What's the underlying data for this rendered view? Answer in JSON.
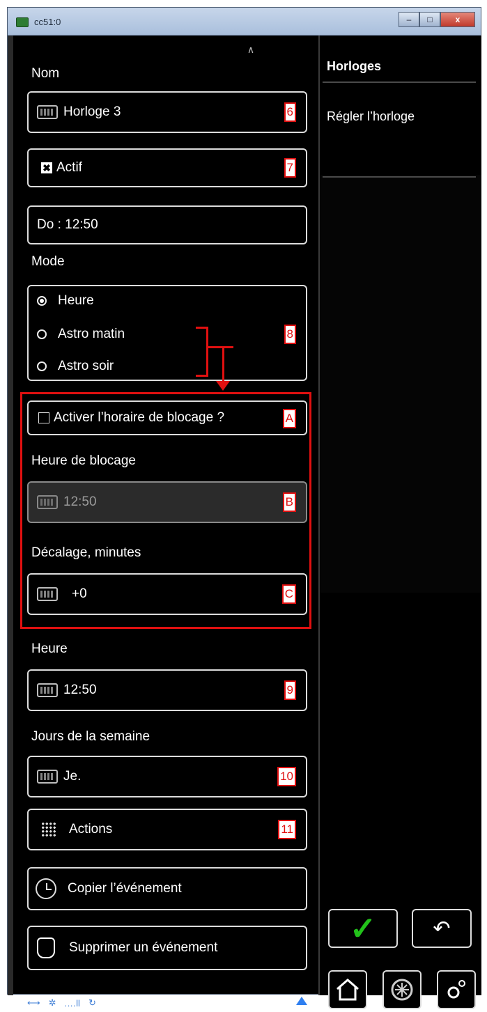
{
  "window": {
    "title": "cc51:0",
    "minimize_label": "–",
    "maximize_label": "□",
    "close_label": "x"
  },
  "form": {
    "nom_label": "Nom",
    "nom_value": "Horloge 3",
    "actif_label": "Actif",
    "date_value": "Do : 12:50",
    "mode_label": "Mode",
    "modes": [
      "Heure",
      "Astro matin",
      "Astro soir"
    ],
    "blocage_checkbox_label": "Activer l’horaire de blocage ?",
    "heure_blocage_label": "Heure de blocage",
    "heure_blocage_value": "12:50",
    "decalage_label": "Décalage, minutes",
    "decalage_value": "+0",
    "heure_label": "Heure",
    "heure_value": "12:50",
    "jours_label": "Jours de la semaine",
    "jours_value": "Je.",
    "actions_label": "Actions",
    "copier_label": "Copier l’événement",
    "supprimer_label": "Supprimer un événement"
  },
  "callouts": {
    "c6": "6",
    "c7": "7",
    "c8": "8",
    "cA": "A",
    "cB": "B",
    "cC": "C",
    "c9": "9",
    "c10": "10",
    "c11": "11"
  },
  "right_panel": {
    "title": "Horloges",
    "item": "Régler l’horloge",
    "confirm": "✓",
    "back": "↶"
  },
  "status": {
    "link": "⟷",
    "antenna": "✲",
    "signal": ".…ll",
    "sync": "↻"
  },
  "colors": {
    "accent_red": "#e01010",
    "confirm_green": "#22c21a",
    "status_blue": "#2f7ff0"
  },
  "icons": [
    "keyboard-icon",
    "checkbox-checked-icon",
    "radio-icon",
    "grid-icon",
    "clock-icon",
    "trash-icon",
    "home-icon",
    "logo-icon",
    "settings-icon"
  ]
}
